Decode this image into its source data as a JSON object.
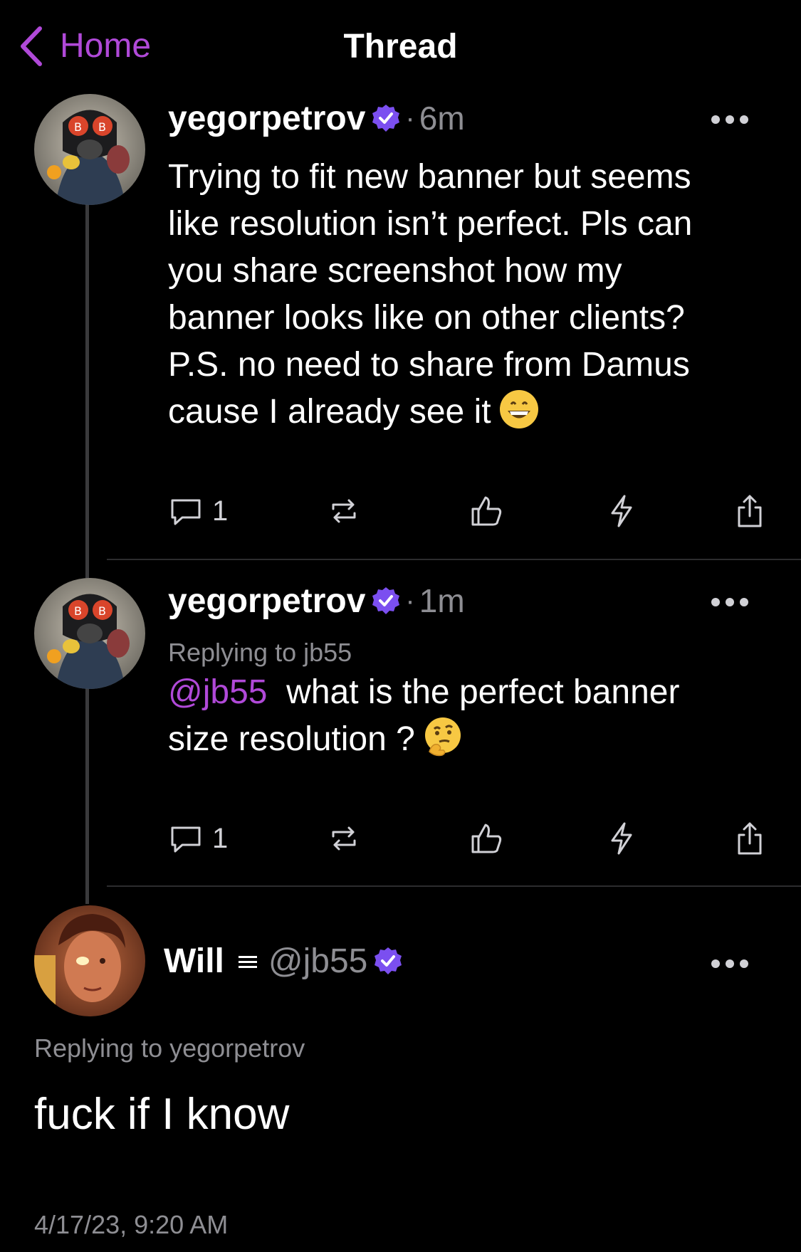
{
  "nav": {
    "back_label": "Home",
    "title": "Thread"
  },
  "colors": {
    "accent": "#b049d8",
    "background": "#000000",
    "muted": "#8e8e93",
    "verified": "#7b4ff0"
  },
  "posts": [
    {
      "username": "yegorpetrov",
      "dot": "·",
      "time": "6m",
      "lines": [
        "Trying to fit new banner but seems",
        "like resolution isn’t perfect. Pls can",
        "you share screenshot how my",
        "banner looks like on other clients?",
        "P.S. no need to share from Damus",
        "cause I already see it"
      ],
      "emoji": "grinning-face",
      "reply_count": "1"
    },
    {
      "username": "yegorpetrov",
      "dot": "·",
      "time": "1m",
      "replying_to": "Replying to jb55",
      "mention": "@jb55",
      "line1": "what is the perfect banner",
      "line2": "size resolution ?",
      "emoji": "thinking-face",
      "reply_count": "1"
    }
  ],
  "main_post": {
    "name": "Will",
    "handle": "@jb55",
    "replying_to": "Replying to yegorpetrov",
    "text": "fuck if I know",
    "timestamp": "4/17/23, 9:20 AM"
  },
  "icons": [
    "chevron-left-icon",
    "verified-badge-icon",
    "more-icon",
    "reply-icon",
    "repost-icon",
    "like-icon",
    "zap-icon",
    "share-icon",
    "menu-icon"
  ]
}
